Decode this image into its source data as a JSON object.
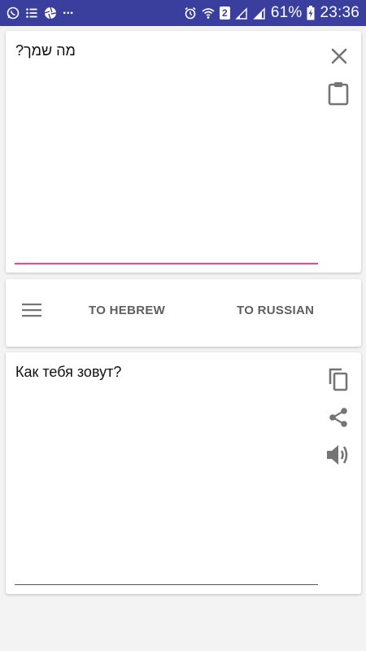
{
  "status_bar": {
    "battery": "61%",
    "time": "23:36",
    "sim_slot": "2",
    "overflow": "..."
  },
  "source": {
    "text": "מה שמך?"
  },
  "toolbar": {
    "to_hebrew": "TO HEBREW",
    "to_russian": "TO RUSSIAN"
  },
  "result": {
    "text": "Как тебя зовут?"
  },
  "colors": {
    "status_bar": "#3a3f9e",
    "accent": "#ff4081",
    "icon_gray": "#757575"
  }
}
